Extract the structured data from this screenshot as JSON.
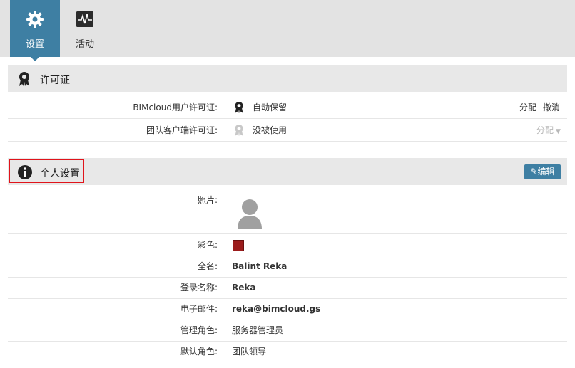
{
  "tabs": [
    {
      "label": "设置",
      "icon": "gear-icon",
      "active": true
    },
    {
      "label": "活动",
      "icon": "activity-icon",
      "active": false
    }
  ],
  "license_section": {
    "title": "许可证",
    "icon": "license-badge-icon",
    "rows": [
      {
        "label": "BIMcloud用户许可证:",
        "value": "自动保留",
        "actions": [
          "分配",
          "撤消"
        ]
      },
      {
        "label": "团队客户端许可证:",
        "value": "没被使用",
        "actions": [
          "分配"
        ]
      }
    ]
  },
  "personal_section": {
    "title": "个人设置",
    "icon": "info-icon",
    "edit_label": "编辑",
    "rows": {
      "photo_label": "照片:",
      "color_label": "彩色:",
      "color_value": "#9b1c1c",
      "fullname_label": "全名:",
      "fullname": "Balint Reka",
      "login_label": "登录名称:",
      "login": "Reka",
      "email_label": "电子邮件:",
      "email": "reka@bimcloud.gs",
      "admin_role_label": "管理角色:",
      "admin_role": "服务器管理员",
      "default_role_label": "默认角色:",
      "default_role": "团队领导"
    }
  },
  "colors": {
    "accent": "#3e7fa3",
    "highlight": "#e0141b"
  }
}
